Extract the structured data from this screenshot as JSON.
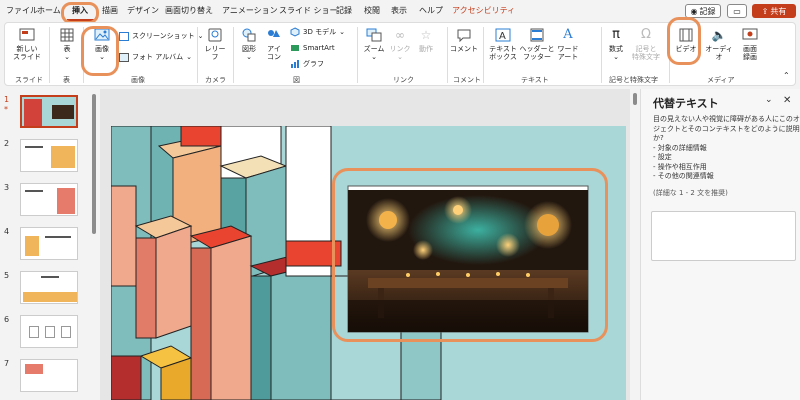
{
  "tabs": [
    "ファイル",
    "ホーム",
    "挿入",
    "描画",
    "デザイン",
    "画面切り替え",
    "アニメーション",
    "スライド ショー",
    "記録",
    "校閲",
    "表示",
    "ヘルプ",
    "アクセシビリティ"
  ],
  "topright": {
    "record": "記録",
    "share": "共有"
  },
  "ribbon": {
    "slides": {
      "new_slide": "新しい\nスライド",
      "group": "スライド"
    },
    "tables": {
      "table": "表",
      "group": "表"
    },
    "images": {
      "pictures": "画像",
      "screenshot": "スクリーンショット",
      "photo_album": "フォト アルバム",
      "group": "画像"
    },
    "camera": {
      "cameo": "レリー\nフ",
      "group": "カメラ"
    },
    "illustrations": {
      "shapes": "図形",
      "icons": "アイ\nコン",
      "models": "3D モデル",
      "smartart": "SmartArt",
      "chart": "グラフ",
      "group": "図"
    },
    "links": {
      "zoom": "ズーム",
      "link": "リンク",
      "action": "動作",
      "group": "リンク"
    },
    "comments": {
      "comment": "コメント",
      "group": "コメント"
    },
    "text": {
      "textbox": "テキスト\nボックス",
      "header": "ヘッダーと\nフッター",
      "wordart": "ワード\nアート",
      "group": "テキスト"
    },
    "symbols": {
      "equation": "数式",
      "symbol": "記号と\n特殊文字",
      "group": "記号と特殊文字"
    },
    "media": {
      "video": "ビデオ",
      "audio": "オーディオ",
      "screenrec": "画面\n録画",
      "group": "メディア"
    }
  },
  "slide_numbers": [
    "1",
    "2",
    "3",
    "4",
    "5",
    "6",
    "7"
  ],
  "alt_text": {
    "title": "代替テキスト",
    "description": [
      "目の見えない人や視覚に障碍がある人にこのオブ",
      "ジェクトとそのコンテキストをどのように説明します",
      "か?",
      "- 対象の詳細情報",
      "- 設定",
      "- 操作や相互作用",
      "- その他の関連情報"
    ],
    "hint": "(詳細な 1 - 2 文を推奨)"
  },
  "colors": {
    "accent": "#c43e1c",
    "highlight": "#e9915a",
    "slide_bg": "#a9d6d6"
  }
}
